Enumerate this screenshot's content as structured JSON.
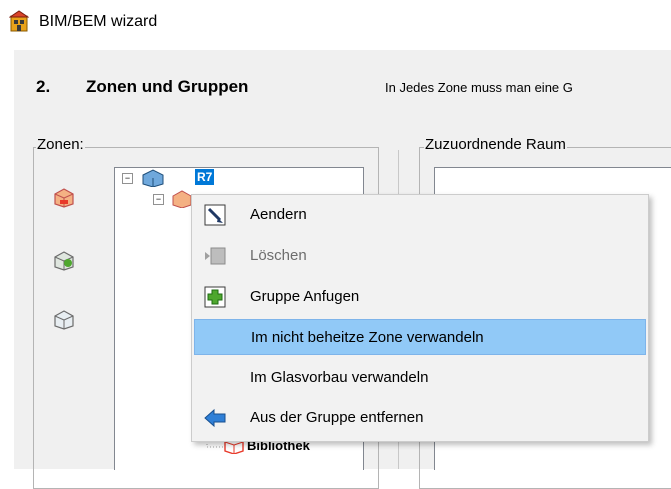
{
  "window": {
    "title": "BIM/BEM wizard",
    "icon": "building-app-icon"
  },
  "step": {
    "number": "2.",
    "title": "Zonen und Gruppen",
    "hint": "In Jedes Zone muss man eine G"
  },
  "zones_panel": {
    "label": "Zonen:",
    "icons": [
      "heated-zone-icon",
      "add-zone-icon",
      "unheated-zone-icon"
    ],
    "tree": {
      "selected_node": "R7",
      "visible_child": "Bibliothek"
    }
  },
  "rooms_panel": {
    "label": "Zuzuordnende Raum"
  },
  "context_menu": {
    "items": [
      {
        "label": "Aendern",
        "icon": "edit-icon",
        "enabled": true
      },
      {
        "label": "Löschen",
        "icon": "delete-icon",
        "enabled": false
      },
      {
        "label": "Gruppe Anfugen",
        "icon": "add-group-icon",
        "enabled": true
      },
      {
        "label": "Im nicht beheitze Zone verwandeln",
        "icon": "",
        "enabled": true,
        "highlighted": true
      },
      {
        "label": "Im Glasvorbau verwandeln",
        "icon": "",
        "enabled": true
      },
      {
        "label": "Aus der Gruppe entfernen",
        "icon": "arrow-left-icon",
        "enabled": true
      }
    ]
  },
  "colors": {
    "selection": "#0078d7",
    "menu_highlight": "#91c9f7",
    "dialog_bg": "#f0f0f0"
  }
}
